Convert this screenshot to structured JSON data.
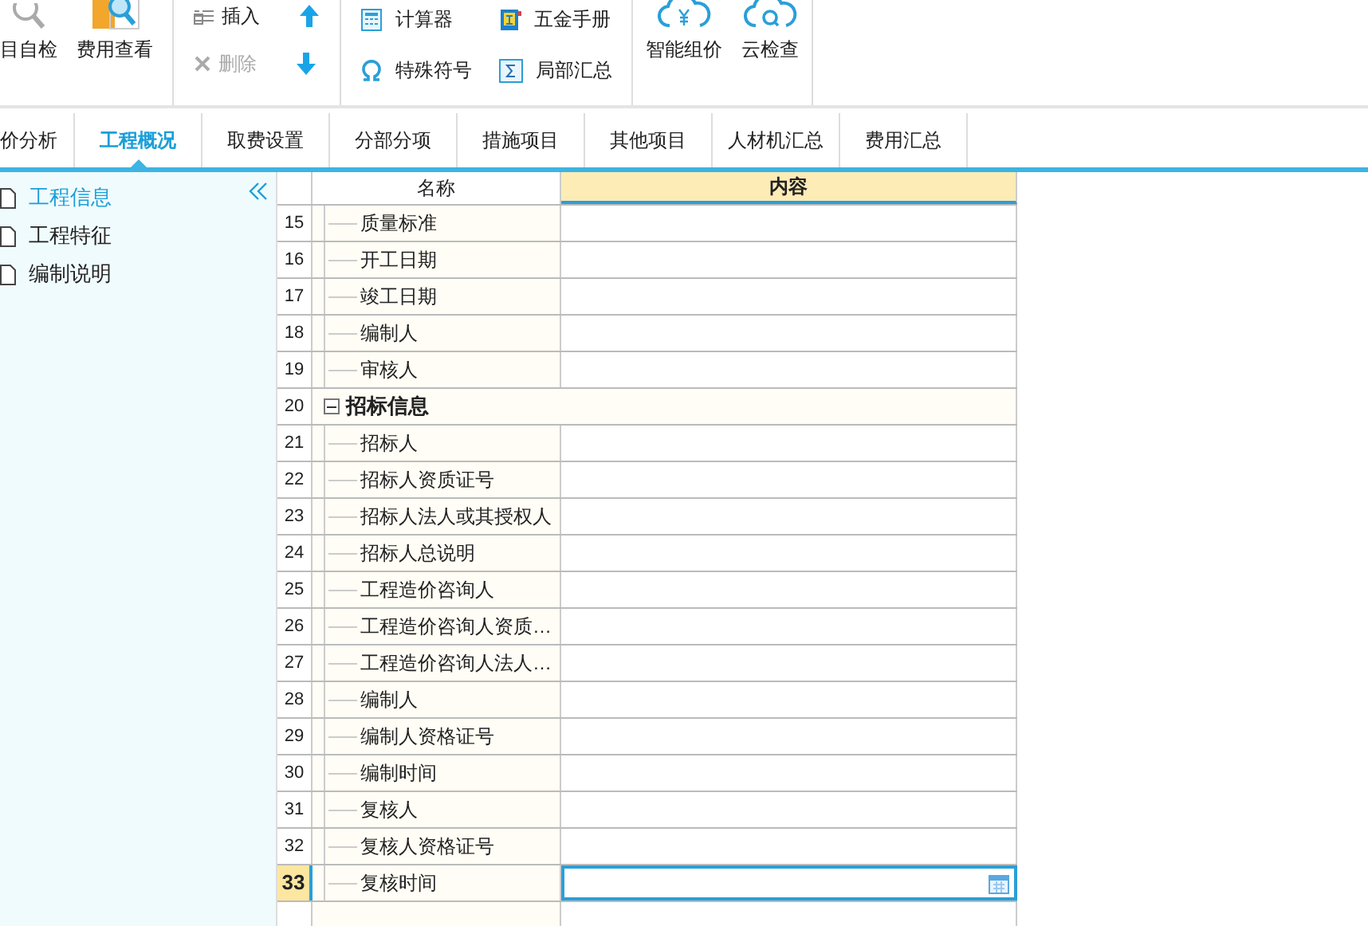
{
  "toolbar": {
    "large_buttons": [
      {
        "label": "目自检"
      },
      {
        "label": "费用查看"
      }
    ],
    "edit_buttons": [
      {
        "label": "插入",
        "disabled": false
      },
      {
        "label": "删除",
        "disabled": true
      }
    ],
    "tools": [
      {
        "label": "计算器",
        "kind": "calculator"
      },
      {
        "label": "特殊符号",
        "kind": "omega"
      },
      {
        "label": "五金手册",
        "kind": "book"
      },
      {
        "label": "局部汇总",
        "kind": "sigma"
      }
    ],
    "cloud_buttons": [
      {
        "label": "智能组价",
        "kind": "price"
      },
      {
        "label": "云检查",
        "kind": "check"
      }
    ]
  },
  "tabs": [
    {
      "label": "价分析",
      "selected": false
    },
    {
      "label": "工程概况",
      "selected": true
    },
    {
      "label": "取费设置",
      "selected": false
    },
    {
      "label": "分部分项",
      "selected": false
    },
    {
      "label": "措施项目",
      "selected": false
    },
    {
      "label": "其他项目",
      "selected": false
    },
    {
      "label": "人材机汇总",
      "selected": false
    },
    {
      "label": "费用汇总",
      "selected": false
    }
  ],
  "sidebar": {
    "items": [
      {
        "label": "工程信息",
        "selected": true
      },
      {
        "label": "工程特征",
        "selected": false
      },
      {
        "label": "编制说明",
        "selected": false
      }
    ]
  },
  "table": {
    "columns": [
      "名称",
      "内容"
    ],
    "rows": [
      {
        "number": "15",
        "name": "质量标准",
        "kind": "item",
        "selected": false
      },
      {
        "number": "16",
        "name": "开工日期",
        "kind": "item",
        "selected": false
      },
      {
        "number": "17",
        "name": "竣工日期",
        "kind": "item",
        "selected": false
      },
      {
        "number": "18",
        "name": "编制人",
        "kind": "item",
        "selected": false
      },
      {
        "number": "19",
        "name": "审核人",
        "kind": "item",
        "selected": false
      },
      {
        "number": "20",
        "name": "招标信息",
        "kind": "group",
        "expanded": true,
        "selected": false
      },
      {
        "number": "21",
        "name": "招标人",
        "kind": "item",
        "selected": false
      },
      {
        "number": "22",
        "name": "招标人资质证号",
        "kind": "item",
        "selected": false
      },
      {
        "number": "23",
        "name": "招标人法人或其授权人",
        "kind": "item",
        "selected": false
      },
      {
        "number": "24",
        "name": "招标人总说明",
        "kind": "item",
        "selected": false
      },
      {
        "number": "25",
        "name": "工程造价咨询人",
        "kind": "item",
        "selected": false
      },
      {
        "number": "26",
        "name": "工程造价咨询人资质…",
        "kind": "item",
        "selected": false
      },
      {
        "number": "27",
        "name": "工程造价咨询人法人…",
        "kind": "item",
        "selected": false
      },
      {
        "number": "28",
        "name": "编制人",
        "kind": "item",
        "selected": false
      },
      {
        "number": "29",
        "name": "编制人资格证号",
        "kind": "item",
        "selected": false
      },
      {
        "number": "30",
        "name": "编制时间",
        "kind": "item",
        "selected": false
      },
      {
        "number": "31",
        "name": "复核人",
        "kind": "item",
        "selected": false
      },
      {
        "number": "32",
        "name": "复核人资格证号",
        "kind": "item",
        "selected": false
      },
      {
        "number": "33",
        "name": "复核时间",
        "kind": "item",
        "selected": true
      }
    ]
  }
}
